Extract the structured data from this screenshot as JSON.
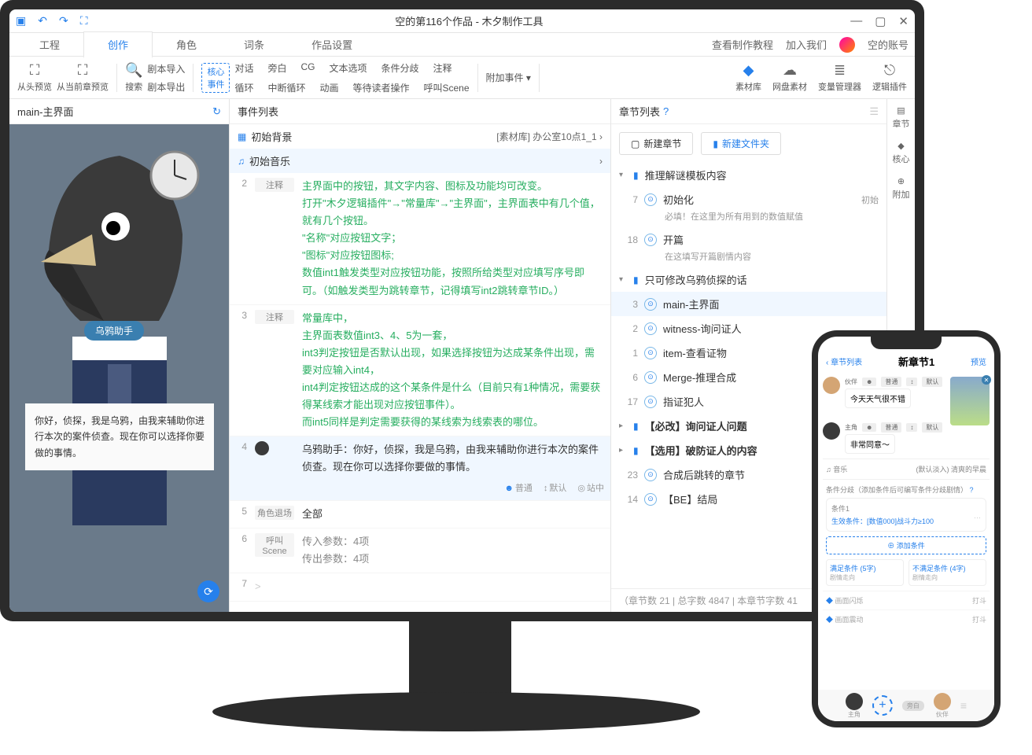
{
  "titlebar": {
    "title": "空的第116个作品 - 木夕制作工具"
  },
  "tabs": {
    "l0": "工程",
    "l1": "创作",
    "l2": "角色",
    "l3": "词条",
    "l4": "作品设置"
  },
  "tabRight": {
    "tutorial": "查看制作教程",
    "join": "加入我们",
    "account": "空的账号"
  },
  "toolbar": {
    "preview_start": "从头预览",
    "preview_cur": "从当前章预览",
    "search": "搜索",
    "import": "剧本导入",
    "export": "剧本导出",
    "core": "核心\n事件",
    "r1": {
      "c0": "对话",
      "c1": "旁白",
      "c2": "CG",
      "c3": "文本选项",
      "c4": "条件分歧",
      "c5": "注释"
    },
    "r2": {
      "c0": "循环",
      "c1": "中断循环",
      "c2": "动画",
      "c3": "等待读者操作",
      "c4": "呼叫Scene"
    },
    "append": "附加事件",
    "right": {
      "assets": "素材库",
      "cloud": "网盘素材",
      "vars": "变量管理器",
      "logic": "逻辑插件"
    }
  },
  "preview": {
    "header": "main-主界面",
    "name": "乌鸦助手",
    "dialogue": "你好，侦探，我是乌鸦，由我来辅助你进行本次的案件侦查。现在你可以选择你要做的事情。"
  },
  "events": {
    "header": "事件列表",
    "bg": "初始背景",
    "bg_info": "[素材库] 办公室10点1_1",
    "music": "初始音乐",
    "row2": {
      "num": "2",
      "type": "注释",
      "text": "主界面中的按钮，其文字内容、图标及功能均可改变。\n打开\"木夕逻辑插件\"→\"常量库\"→\"主界面\"，主界面表中有几个值，就有几个按钮。\n\"名称\"对应按钮文字；\n\"图标\"对应按钮图标;\n数值int1触发类型对应按钮功能，按照所给类型对应填写序号即可。（如触发类型为跳转章节，记得填写int2跳转章节ID。）"
    },
    "row3": {
      "num": "3",
      "type": "注释",
      "text": "常量库中，\n主界面表数值int3、4、5为一套，\nint3判定按钮是否默认出现，如果选择按钮为达成某条件出现，需要对应输入int4，\nint4判定按钮达成的这个某条件是什么（目前只有1种情况，需要获得某线索才能出现对应按钮事件）。\n而int5同样是判定需要获得的某线索为线索表的哪位。"
    },
    "row4": {
      "num": "4",
      "text": "乌鸦助手：你好，侦探，我是乌鸦，由我来辅助你进行本次的案件侦查。现在你可以选择你要做的事情。",
      "m1": "普通",
      "m2": "默认",
      "m3": "站中"
    },
    "row5": {
      "num": "5",
      "type": "角色退场",
      "text": "全部"
    },
    "row6": {
      "num": "6",
      "type": "呼叫Scene",
      "p1": "传入参数：4项",
      "p2": "传出参数：4项"
    },
    "row7": {
      "num": "7",
      "text": ">"
    }
  },
  "chapters": {
    "header": "章节列表",
    "newChap": "新建章节",
    "newFolder": "新建文件夹",
    "f1": "推理解谜模板内容",
    "c7": {
      "n": "7",
      "t": "初始化",
      "d": "必填！在这里为所有用到的数值赋值",
      "tag": "初始"
    },
    "c18": {
      "n": "18",
      "t": "开篇",
      "d": "在这填写开篇剧情内容"
    },
    "f2": "只可修改乌鸦侦探的话",
    "c3": {
      "n": "3",
      "t": "main-主界面"
    },
    "c2": {
      "n": "2",
      "t": "witness-询问证人"
    },
    "c1": {
      "n": "1",
      "t": "item-查看证物"
    },
    "c6": {
      "n": "6",
      "t": "Merge-推理合成"
    },
    "c17": {
      "n": "17",
      "t": "指证犯人"
    },
    "f3": "【必改】询问证人问题",
    "f4": "【选用】破防证人的内容",
    "c23": {
      "n": "23",
      "t": "合成后跳转的章节"
    },
    "c14": {
      "n": "14",
      "t": "【BE】结局"
    },
    "stats": "（章节数 21 | 总字数 4847 | 本章节字数 41"
  },
  "rightIcons": {
    "i1": "章节",
    "i2": "核心",
    "i3": "附加"
  },
  "phone": {
    "back": "章节列表",
    "title": "新章节1",
    "action": "预览",
    "m1": {
      "name": "伙伴",
      "chip1": "普通",
      "chip2": "默认",
      "text": "今天天气很不错"
    },
    "m2": {
      "name": "主角",
      "chip1": "普通",
      "chip2": "默认",
      "text": "非常同意～"
    },
    "music": "音乐",
    "music_r": "(默认淡入) 清爽的早晨",
    "branch_title": "条件分歧（添加条件后可编写条件分歧剧情）",
    "cond_label": "条件1",
    "cond_text": "生效条件：[数值000]战斗力≥100",
    "add_cond": "⊕ 添加条件",
    "satisfy": "满足条件 (5字)",
    "unsatisfy": "不满足条件 (4字)",
    "sub": "剧情走向",
    "e1": "画面闪烁",
    "e2": "画面震动",
    "e_tag": "打斗",
    "bottom": {
      "l1": "主角",
      "l2": "旁白",
      "l3": "伙伴"
    }
  }
}
